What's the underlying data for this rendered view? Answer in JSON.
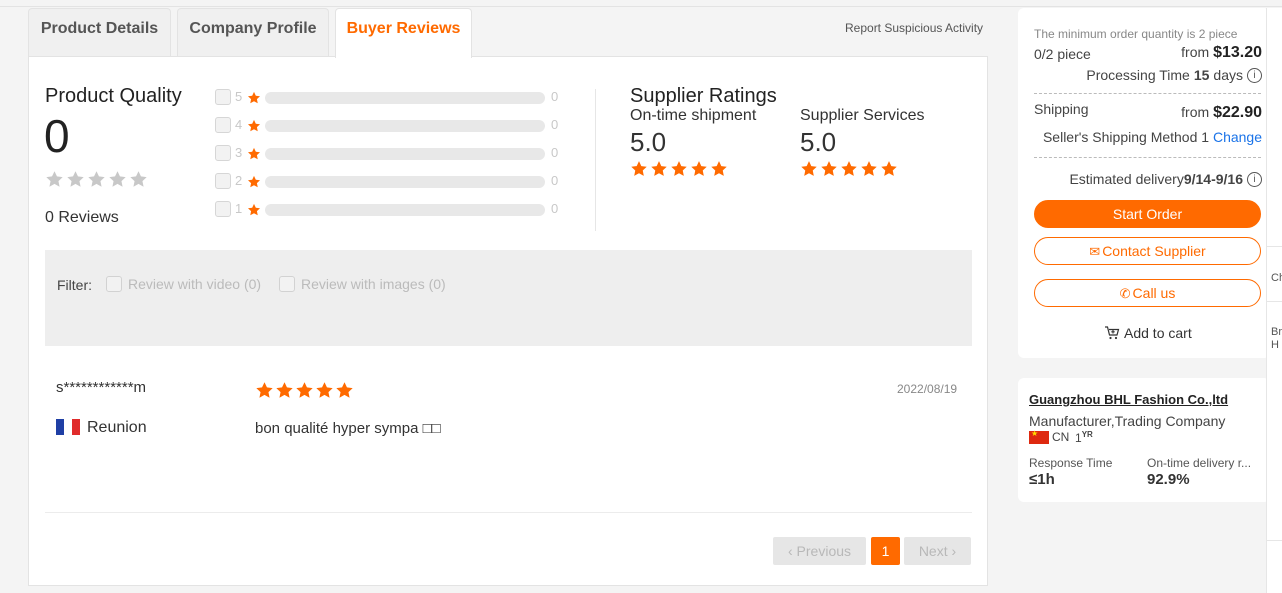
{
  "tabs": [
    {
      "label": "Product Details",
      "active": false
    },
    {
      "label": "Company Profile",
      "active": false
    },
    {
      "label": "Buyer Reviews",
      "active": true
    }
  ],
  "report_link": "Report Suspicious Activity",
  "product_quality": {
    "title": "Product Quality",
    "score": "0",
    "stars_filled": 0,
    "reviews": "0 Reviews",
    "distribution": [
      {
        "stars": "5",
        "count": "0",
        "fraction": 0
      },
      {
        "stars": "4",
        "count": "0",
        "fraction": 0
      },
      {
        "stars": "3",
        "count": "0",
        "fraction": 0
      },
      {
        "stars": "2",
        "count": "0",
        "fraction": 0
      },
      {
        "stars": "1",
        "count": "0",
        "fraction": 0
      }
    ]
  },
  "supplier_ratings": {
    "title": "Supplier Ratings",
    "items": [
      {
        "label": "On-time shipment",
        "value": "5.0",
        "stars": 5
      },
      {
        "label": "Supplier Services",
        "value": "5.0",
        "stars": 5
      }
    ]
  },
  "filter": {
    "label": "Filter:",
    "options": [
      "Review with video (0)",
      "Review with images (0)"
    ]
  },
  "review": {
    "user": "s************m",
    "stars": 5,
    "date": "2022/08/19",
    "country": "Reunion",
    "text": "bon qualité hyper sympa □□"
  },
  "pagination": {
    "prev": "Previous",
    "page": "1",
    "next": "Next"
  },
  "order": {
    "min_order": "The minimum order quantity is 2 piece",
    "quantity": "0/2 piece",
    "price_prefix": "from",
    "price": "$13.20",
    "processing_prefix": "Processing Time",
    "processing_days": "15",
    "processing_unit": "days",
    "shipping_label": "Shipping",
    "shipping_price": "$22.90",
    "shipping_method": "Seller's Shipping Method 1",
    "change_label": "Change",
    "est_label": "Estimated delivery",
    "est_value": "9/14-9/16",
    "start_order": "Start Order",
    "contact_supplier": "Contact Supplier",
    "call_us": "Call us",
    "add_to_cart": "Add to cart"
  },
  "company": {
    "name": "Guangzhou BHL Fashion Co.,ltd",
    "type": "Manufacturer,Trading Company",
    "country": "CN",
    "years": "1",
    "years_unit": "YR",
    "response_label": "Response Time",
    "response_value": "≤1h",
    "ontime_label": "On-time delivery r...",
    "ontime_value": "92.9%"
  },
  "side": {
    "t1": "Ch",
    "t2a": "Br",
    "t2b": "H"
  },
  "colors": {
    "accent": "#ff6a00",
    "link": "#1a73e8",
    "star_empty": "#c8c8c8"
  }
}
